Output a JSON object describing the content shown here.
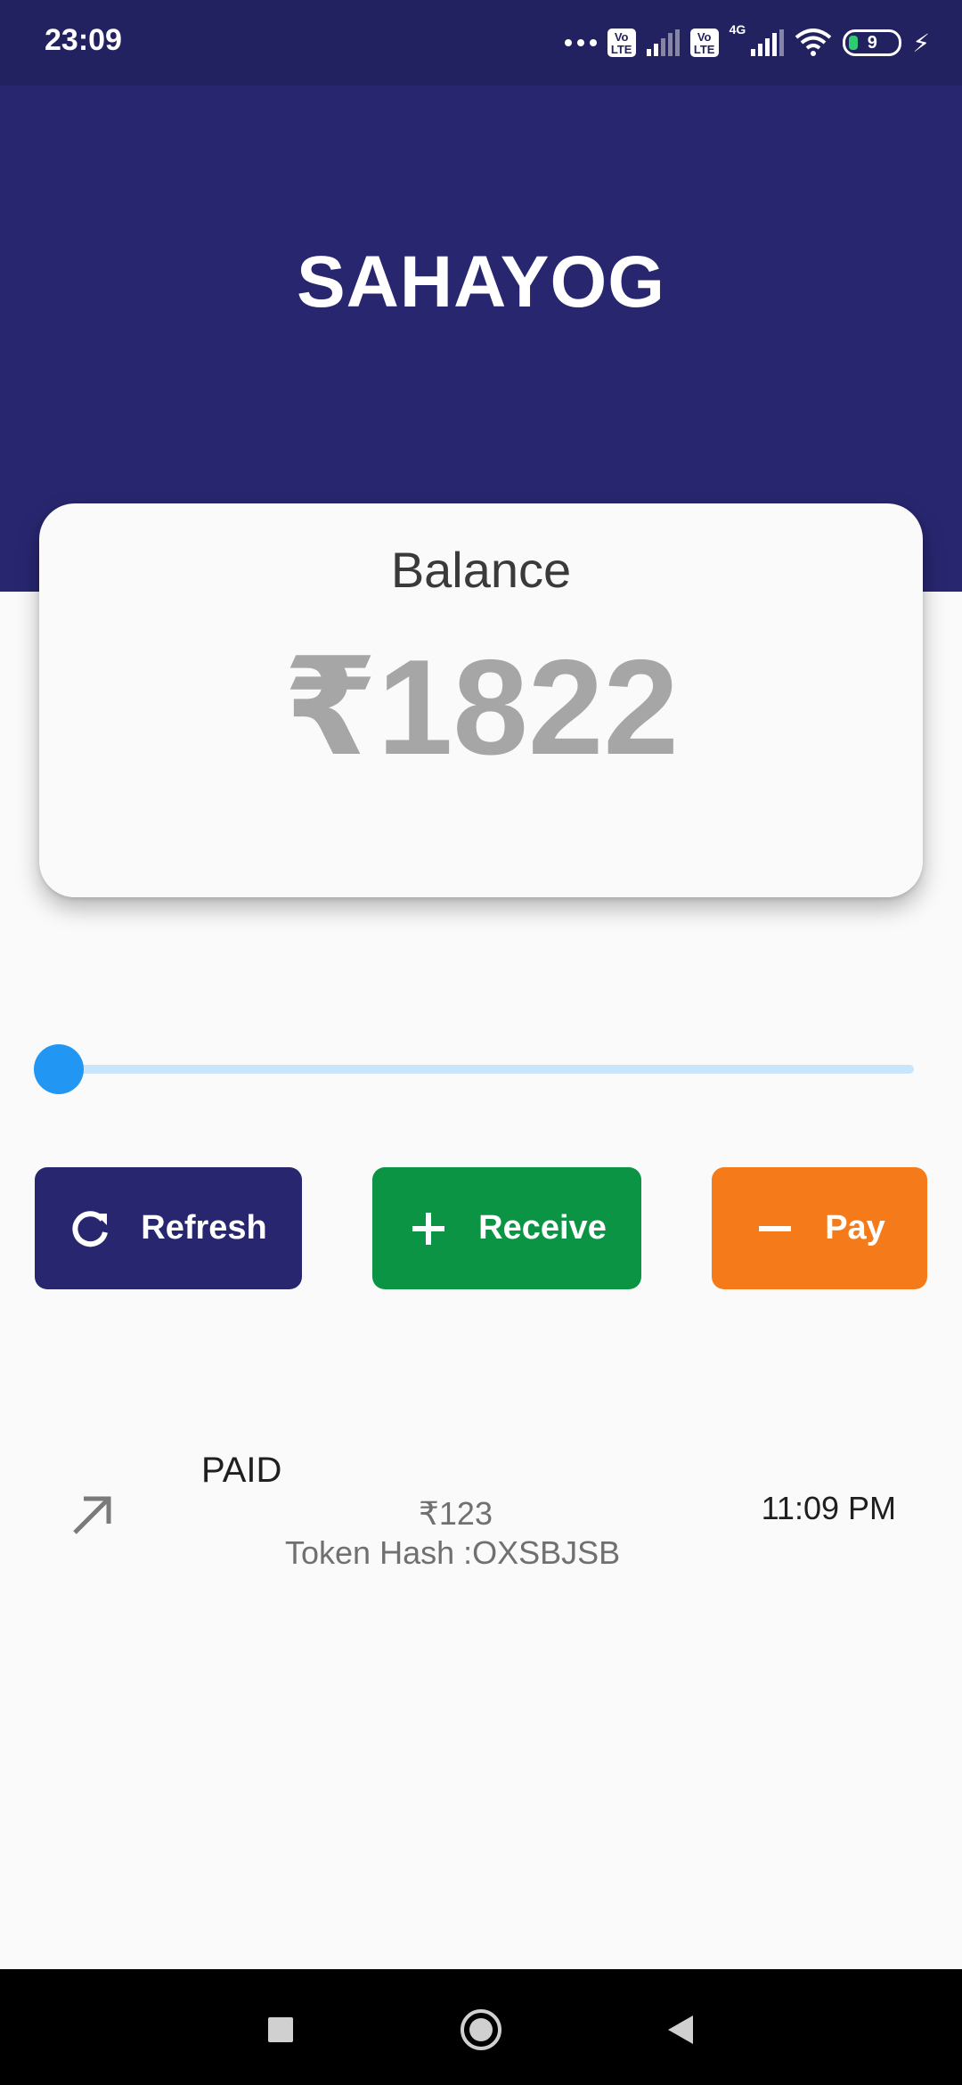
{
  "status_bar": {
    "time": "23:09",
    "network": "4G",
    "volte_1": "Vo\nLTE",
    "volte_2": "Vo\nLTE",
    "battery": "9",
    "icons": [
      "more-dots-icon",
      "volte-icon",
      "signal-icon",
      "volte-icon",
      "signal-icon",
      "wifi-icon",
      "battery-icon",
      "charging-icon"
    ]
  },
  "header": {
    "title": "SAHAYOG",
    "background_color": "#28266f"
  },
  "balance": {
    "label": "Balance",
    "amount": "₹1822"
  },
  "slider": {
    "value": 0
  },
  "actions": {
    "refresh_label": "Refresh",
    "receive_label": "Receive",
    "pay_label": "Pay",
    "refresh_color": "#28266f",
    "receive_color": "#0b9444",
    "pay_color": "#f57b1a"
  },
  "transactions": [
    {
      "status": "PAID",
      "amount": "₹123",
      "hash": "Token Hash :OXSBJSB",
      "time": "11:09 PM",
      "icon": "arrow-up-right-icon"
    }
  ],
  "nav": {
    "icons": [
      "recents-icon",
      "home-icon",
      "back-icon"
    ]
  }
}
